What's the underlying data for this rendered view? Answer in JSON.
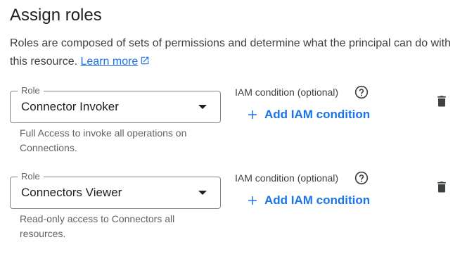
{
  "page": {
    "title": "Assign roles",
    "description": "Roles are composed of sets of permissions and determine what the principal can do with this resource.",
    "learn_more": "Learn more"
  },
  "colors": {
    "accent": "#1a73e8",
    "text": "#202124",
    "muted": "#5f6368",
    "border": "#80868b"
  },
  "roles": [
    {
      "field_label": "Role",
      "value": "Connector Invoker",
      "helper": "Full Access to invoke all operations on Connections.",
      "condition_label": "IAM condition (optional)",
      "add_condition": "Add IAM condition"
    },
    {
      "field_label": "Role",
      "value": "Connectors Viewer",
      "helper": "Read-only access to Connectors all resources.",
      "condition_label": "IAM condition (optional)",
      "add_condition": "Add IAM condition"
    }
  ],
  "icons": {
    "external_link": "external-link-icon",
    "help": "help-circle-icon",
    "add": "plus-icon",
    "delete": "trash-icon",
    "dropdown": "chevron-down-icon"
  }
}
